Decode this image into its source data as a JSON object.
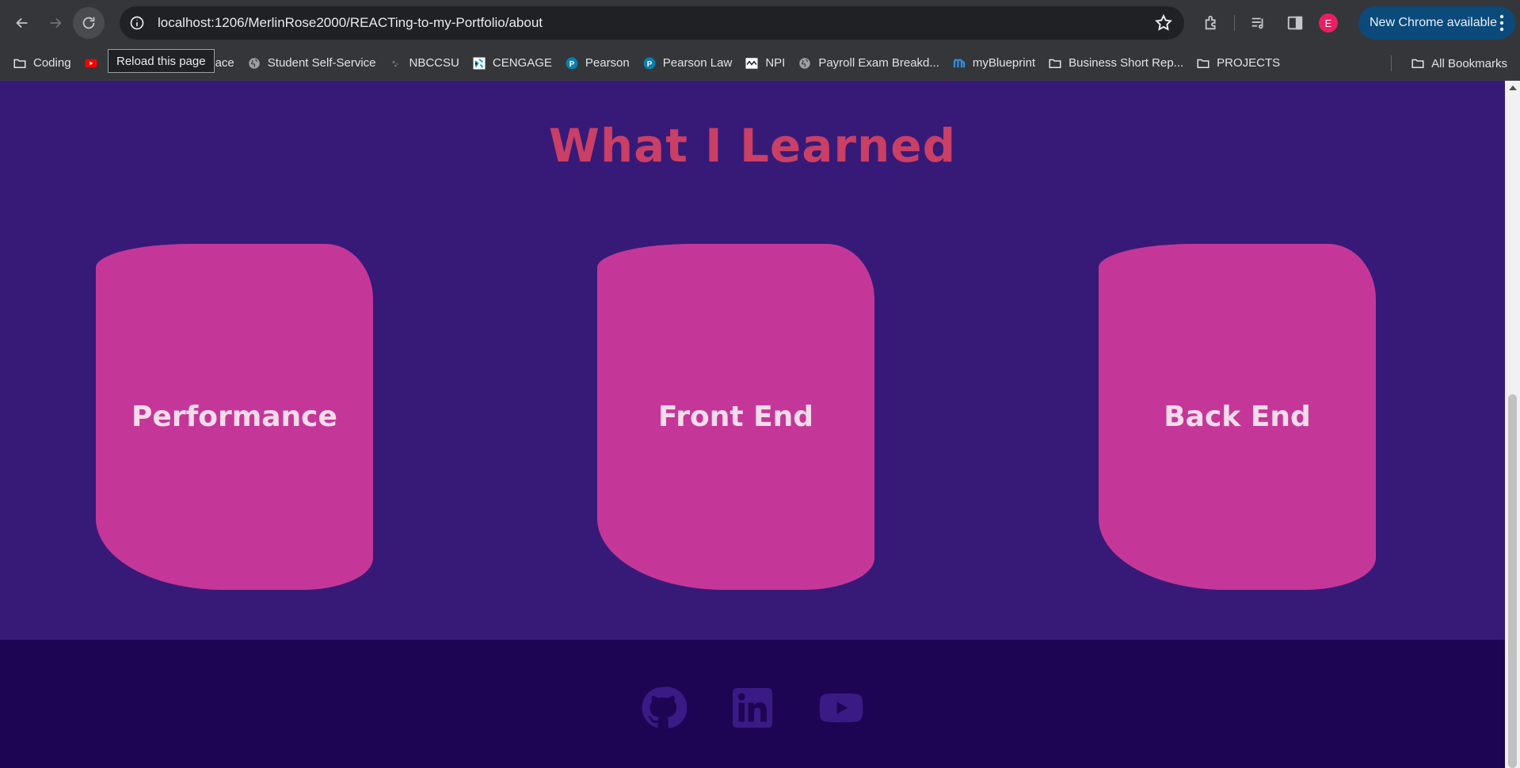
{
  "browser": {
    "url": "localhost:1206/MerlinRose2000/REACTing-to-my-Portfolio/about",
    "update_label": "New Chrome available",
    "avatar_initial": "E",
    "tooltip": "Reload this page"
  },
  "bookmarks": {
    "items": [
      {
        "label": "Coding",
        "icon": "folder-icon"
      },
      {
        "label": "",
        "icon": "youtube-icon"
      },
      {
        "label": "ightspace",
        "icon": "none"
      },
      {
        "label": "Student Self-Service",
        "icon": "globe-icon"
      },
      {
        "label": "NBCCSU",
        "icon": "nbccsu-icon"
      },
      {
        "label": "CENGAGE",
        "icon": "cengage-icon"
      },
      {
        "label": "Pearson",
        "icon": "pearson-icon"
      },
      {
        "label": "Pearson Law",
        "icon": "pearson-icon"
      },
      {
        "label": "NPI",
        "icon": "npi-icon"
      },
      {
        "label": "Payroll Exam Breakd...",
        "icon": "globe-icon"
      },
      {
        "label": "myBlueprint",
        "icon": "myblueprint-icon"
      },
      {
        "label": "Business Short Rep...",
        "icon": "folder-icon"
      },
      {
        "label": "PROJECTS",
        "icon": "folder-icon"
      }
    ],
    "all_bookmarks": "All Bookmarks"
  },
  "page": {
    "title": "What I Learned",
    "cards": [
      "Performance",
      "Front End",
      "Back End"
    ]
  },
  "footer": {
    "icons": [
      "github-icon",
      "linkedin-icon",
      "youtube-icon"
    ]
  },
  "colors": {
    "background": "#371a78",
    "title": "#c93f66",
    "card": "#c43799",
    "footer": "#1e0553"
  }
}
